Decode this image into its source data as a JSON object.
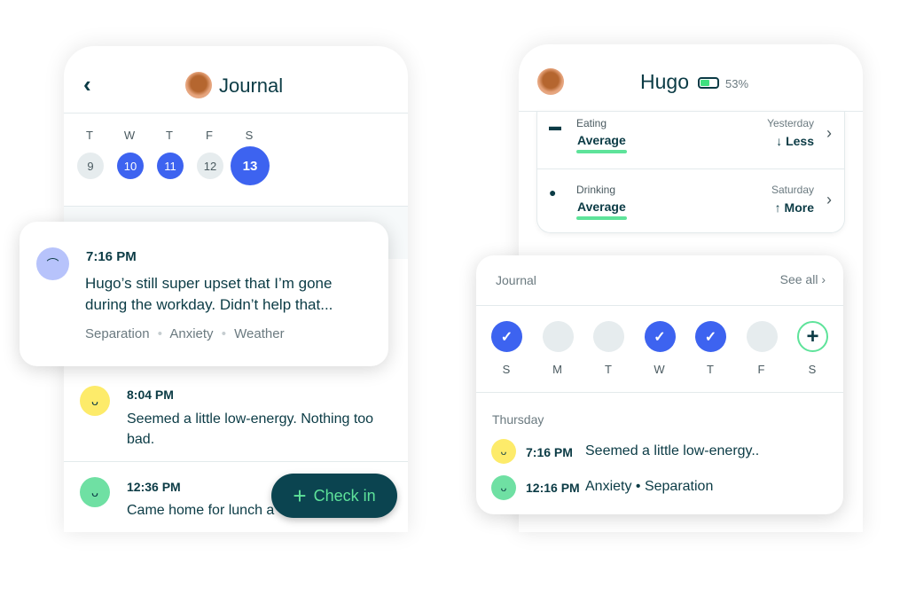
{
  "left": {
    "title": "Journal",
    "days": [
      {
        "l": "T",
        "d": "9",
        "s": "g"
      },
      {
        "l": "W",
        "d": "10",
        "s": "b"
      },
      {
        "l": "T",
        "d": "11",
        "s": "b"
      },
      {
        "l": "F",
        "d": "12",
        "s": "g"
      },
      {
        "l": "S",
        "d": "13",
        "s": "b"
      }
    ],
    "popup": {
      "time": "7:16 PM",
      "text1": "Hugo’s still super upset that I’m gone",
      "text2": "during the workday. Didn’t help that...",
      "tags": [
        "Separation",
        "Anxiety",
        "Weather"
      ]
    },
    "entries": [
      {
        "time": "8:04 PM",
        "text1": "Seemed a little low-energy. Nothing too",
        "text2": "bad."
      },
      {
        "time": "12:36 PM",
        "text1": "Came home for lunch a"
      }
    ],
    "checkin": "Check in"
  },
  "right": {
    "name": "Hugo",
    "battery": "53%",
    "battery_level": 0.53,
    "metrics": [
      {
        "label": "Eating",
        "value": "Average",
        "when": "Yesterday",
        "trend": "Less",
        "arrow": "↓",
        "icon": "bowl-icon"
      },
      {
        "label": "Drinking",
        "value": "Average",
        "when": "Saturday",
        "trend": "More",
        "arrow": "↑",
        "icon": "water-drop-icon"
      }
    ],
    "journal": {
      "title": "Journal",
      "see_all": "See all",
      "days": [
        {
          "l": "S",
          "s": "done"
        },
        {
          "l": "M",
          "s": "empty"
        },
        {
          "l": "T",
          "s": "empty"
        },
        {
          "l": "W",
          "s": "done"
        },
        {
          "l": "T",
          "s": "done"
        },
        {
          "l": "F",
          "s": "empty"
        },
        {
          "l": "S",
          "s": "add"
        }
      ],
      "day_label": "Thursday",
      "entries": [
        {
          "time": "7:16 PM",
          "text": "Seemed a little low-energy.."
        },
        {
          "time": "12:16 PM",
          "text": "Anxiety • Separation"
        }
      ]
    }
  },
  "colors": {
    "accent": "#3d63f0",
    "dark": "#0b3b45",
    "green": "#5ee39a",
    "yellow": "#fdeb6a",
    "mint": "#6fe0a3",
    "lavender": "#b7c3fb"
  }
}
